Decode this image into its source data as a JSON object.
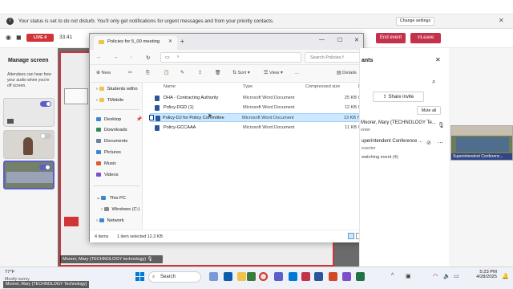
{
  "banner": {
    "message": "Your status is set to do not disturb. You'll only get notifications for urgent messages and from your priority contacts.",
    "change_settings": "Change settings"
  },
  "meeting": {
    "live_label": "LIVE",
    "live_count": "4",
    "timer": "33:41",
    "end_event": "End event",
    "leave": "Leave"
  },
  "left_panel": {
    "title": "Manage screen",
    "description": "Attendees can hear how your audio when you're off screen."
  },
  "explorer": {
    "tab_title": "Policies for 5_00 meeting",
    "search_placeholder": "Search Policies f",
    "commands": {
      "new": "New",
      "sort": "Sort",
      "view": "View",
      "more": "...",
      "details": "Details"
    },
    "columns": {
      "name": "Name",
      "type": "Type",
      "size": "Compressed size",
      "protected": "Pa"
    },
    "sidebar": [
      {
        "label": "Students witho",
        "color": "#f1c24c"
      },
      {
        "label": "TMobile",
        "color": "#f1c24c"
      },
      {
        "label": "Desktop",
        "color": "#3d86d6"
      },
      {
        "label": "Downloads",
        "color": "#2e8b57"
      },
      {
        "label": "Documents",
        "color": "#6b7fa3"
      },
      {
        "label": "Pictures",
        "color": "#3d86d6"
      },
      {
        "label": "Music",
        "color": "#e05a2b"
      },
      {
        "label": "Videos",
        "color": "#7a4fc9"
      },
      {
        "label": "This PC",
        "color": "#3d86d6"
      },
      {
        "label": "Windows (C:)",
        "color": "#888888"
      },
      {
        "label": "Network",
        "color": "#3d86d6"
      }
    ],
    "files": [
      {
        "name": "DHA - Contracting Authority",
        "type": "Microsoft Word Document",
        "size": "25 KB",
        "protected": "No"
      },
      {
        "name": "Policy-DGD (1)",
        "type": "Microsoft Word Document",
        "size": "12 KB",
        "protected": "No"
      },
      {
        "name": "Policy-DJ for Policy Committee",
        "type": "Microsoft Word Document",
        "size": "13 KB",
        "protected": "No"
      },
      {
        "name": "Policy-GCCAAA",
        "type": "Microsoft Word Document",
        "size": "11 KB",
        "protected": "No"
      }
    ],
    "status": {
      "count": "4 items",
      "selected": "1 item selected  12.3 KB"
    }
  },
  "right_panel": {
    "title": "ants",
    "share_invite": "Share invite",
    "mute_all": "Mute all",
    "participant_1": "Moorer, Mary (TECHNOLOGY Te...",
    "participant_1_sub": "enter",
    "participant_2": "uperintendent Conference ...",
    "participant_2_sub": "esenter",
    "watching": "watching event (4)"
  },
  "video": {
    "name": "Superintendent Conferenc..."
  },
  "stage": {
    "presenter_name": "Moorer, Mary (TECHNOLOGY technology)"
  },
  "taskbar": {
    "temp": "77°F",
    "weather": "Mostly sunny",
    "user": "Moorer, Mary (TECHNOLOGY Technology)",
    "search": "Search",
    "time": "5:23 PM",
    "date": "4/28/2025"
  }
}
